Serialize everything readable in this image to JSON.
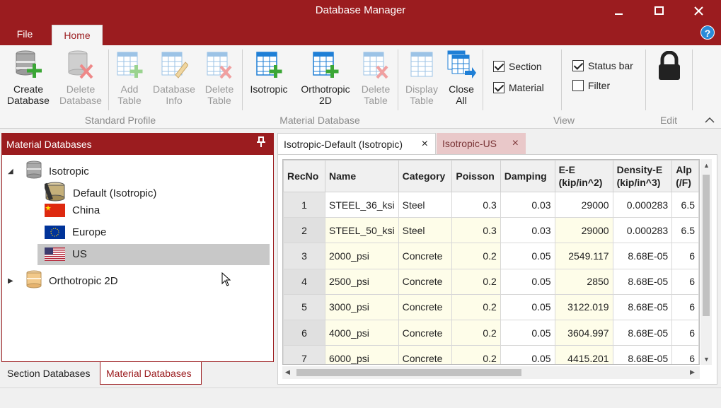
{
  "window": {
    "title": "Database Manager"
  },
  "ribbon_tabs": {
    "file": "File",
    "home": "Home"
  },
  "ribbon": {
    "create_database": [
      "Create",
      "Database"
    ],
    "delete_database": [
      "Delete",
      "Database"
    ],
    "add_table": [
      "Add",
      "Table"
    ],
    "database_info": [
      "Database",
      "Info"
    ],
    "delete_table_sp": [
      "Delete",
      "Table"
    ],
    "isotropic": "Isotropic",
    "orthotropic_2d": [
      "Orthotropic",
      "2D"
    ],
    "delete_table_md": [
      "Delete",
      "Table"
    ],
    "display_table": [
      "Display",
      "Table"
    ],
    "close_all": [
      "Close",
      "All"
    ],
    "groups": {
      "standard_profile": "Standard Profile",
      "material_database": "Material Database",
      "view": "View",
      "edit": "Edit"
    },
    "view_checks": {
      "section": {
        "label": "Section",
        "checked": true
      },
      "material": {
        "label": "Material",
        "checked": true
      },
      "status_bar": {
        "label": "Status bar",
        "checked": true
      },
      "filter": {
        "label": "Filter",
        "checked": false
      }
    }
  },
  "left_panel": {
    "title": "Material Databases",
    "tree": {
      "isotropic": "Isotropic",
      "default": "Default (Isotropic)",
      "china": "China",
      "europe": "Europe",
      "us": "US",
      "orthotropic": "Orthotropic 2D"
    },
    "selected": "US",
    "bottom_tabs": {
      "section": "Section Databases",
      "material": "Material Databases"
    }
  },
  "doc_tabs": {
    "tab1": "Isotropic-Default (Isotropic)",
    "tab2": "Isotropic-US"
  },
  "table": {
    "headers": {
      "recno": "RecNo",
      "name": "Name",
      "category": "Category",
      "poisson": "Poisson",
      "damping": "Damping",
      "ee_line1": "E-E",
      "ee_line2": "(kip/in^2)",
      "dens_line1": "Density-E",
      "dens_line2": "(kip/in^3)",
      "alp_line1": "Alp",
      "alp_line2": "(/F)"
    },
    "rows": [
      {
        "recno": "1",
        "name": "STEEL_36_ksi",
        "category": "Steel",
        "poisson": "0.3",
        "damping": "0.03",
        "ee": "29000",
        "density": "0.000283",
        "alpha": "6.5"
      },
      {
        "recno": "2",
        "name": "STEEL_50_ksi",
        "category": "Steel",
        "poisson": "0.3",
        "damping": "0.03",
        "ee": "29000",
        "density": "0.000283",
        "alpha": "6.5"
      },
      {
        "recno": "3",
        "name": "2000_psi",
        "category": "Concrete",
        "poisson": "0.2",
        "damping": "0.05",
        "ee": "2549.117",
        "density": "8.68E-05",
        "alpha": "6"
      },
      {
        "recno": "4",
        "name": "2500_psi",
        "category": "Concrete",
        "poisson": "0.2",
        "damping": "0.05",
        "ee": "2850",
        "density": "8.68E-05",
        "alpha": "6"
      },
      {
        "recno": "5",
        "name": "3000_psi",
        "category": "Concrete",
        "poisson": "0.2",
        "damping": "0.05",
        "ee": "3122.019",
        "density": "8.68E-05",
        "alpha": "6"
      },
      {
        "recno": "6",
        "name": "4000_psi",
        "category": "Concrete",
        "poisson": "0.2",
        "damping": "0.05",
        "ee": "3604.997",
        "density": "8.68E-05",
        "alpha": "6"
      },
      {
        "recno": "7",
        "name": "6000_psi",
        "category": "Concrete",
        "poisson": "0.2",
        "damping": "0.05",
        "ee": "4415.201",
        "density": "8.68E-05",
        "alpha": "6"
      }
    ]
  },
  "colors": {
    "brand": "#9b1c1f",
    "accent_blue": "#1f7fd6",
    "add_green": "#3aa635",
    "delete_red": "#e05050"
  }
}
